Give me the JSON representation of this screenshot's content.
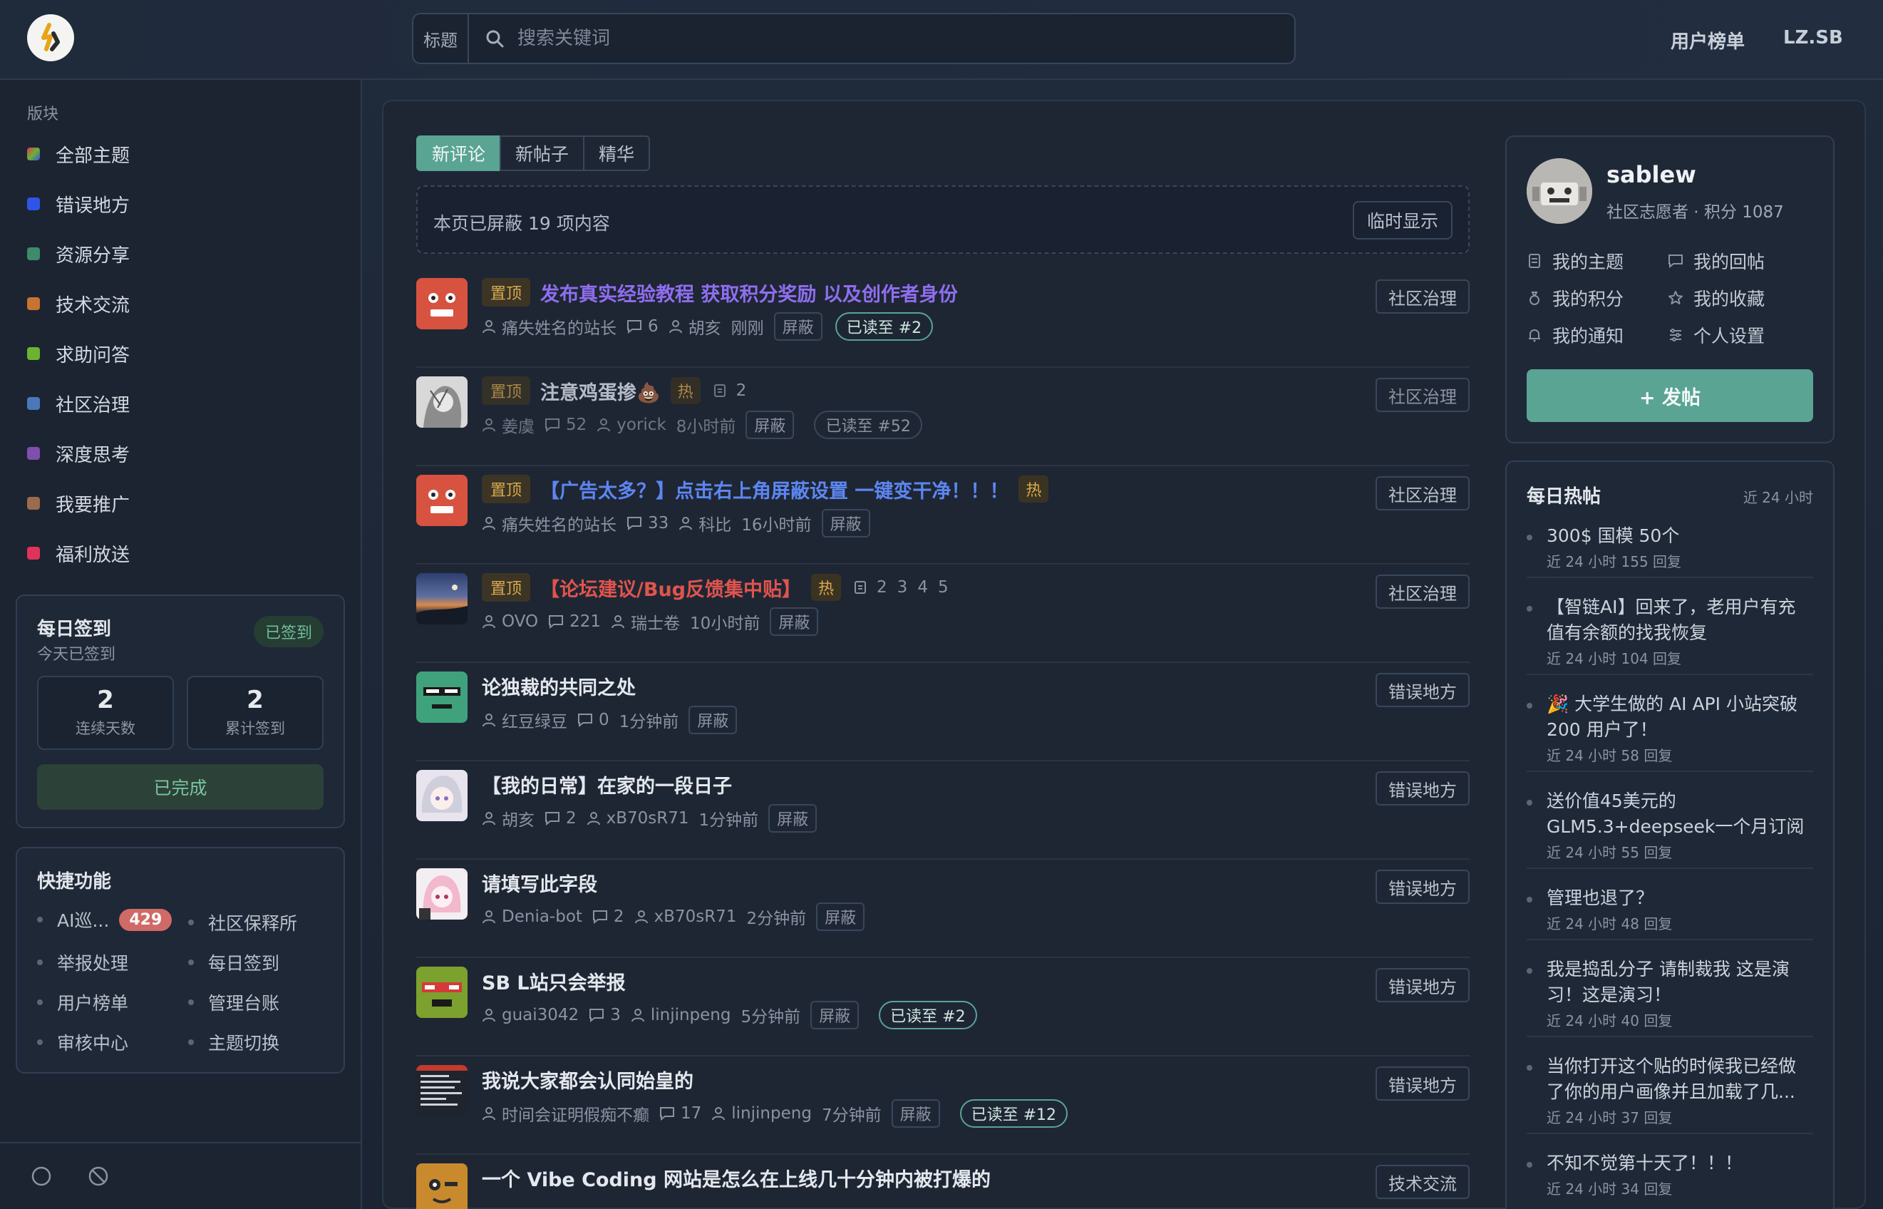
{
  "header": {
    "search_label": "标题",
    "search_placeholder": "搜索关键词",
    "links": [
      "用户榜单",
      "LZ.SB"
    ]
  },
  "sidebar": {
    "section_title": "版块",
    "items": [
      {
        "label": "全部主题",
        "color": "#c9577a"
      },
      {
        "label": "错误地方",
        "color": "#2f55e6"
      },
      {
        "label": "资源分享",
        "color": "#3e8a6a"
      },
      {
        "label": "技术交流",
        "color": "#c6742f"
      },
      {
        "label": "求助问答",
        "color": "#6cb32f"
      },
      {
        "label": "社区治理",
        "color": "#4a78b8"
      },
      {
        "label": "深度思考",
        "color": "#7e4fae"
      },
      {
        "label": "我要推广",
        "color": "#9a6b4d"
      },
      {
        "label": "福利放送",
        "color": "#e0325a"
      }
    ],
    "checkin": {
      "title": "每日签到",
      "subtitle": "今天已签到",
      "badge": "已签到",
      "streak_value": "2",
      "streak_label": "连续天数",
      "total_value": "2",
      "total_label": "累计签到",
      "button": "已完成"
    },
    "quick": {
      "title": "快捷功能",
      "items": [
        {
          "label": "AI巡...",
          "count": "429"
        },
        {
          "label": "社区保释所"
        },
        {
          "label": "举报处理"
        },
        {
          "label": "每日签到"
        },
        {
          "label": "用户榜单"
        },
        {
          "label": "管理台账"
        },
        {
          "label": "审核中心"
        },
        {
          "label": "主题切换"
        }
      ]
    }
  },
  "main": {
    "tabs": [
      "新评论",
      "新帖子",
      "精华"
    ],
    "blocked_text": "本页已屏蔽 19 项内容",
    "blocked_button": "临时显示",
    "posts": [
      {
        "pin": "置顶",
        "title": "发布真实经验教程 获取积分奖励 以及创作者身份",
        "author": "痛失姓名的站长",
        "replies": "6",
        "last": "胡亥",
        "time": "刚刚",
        "shield": "屏蔽",
        "read": "已读至 #2",
        "category": "社区治理"
      },
      {
        "pin": "置顶",
        "title": "注意鸡蛋掺💩",
        "hot": "热",
        "pages": [
          "2"
        ],
        "author": "姜虞",
        "replies": "52",
        "last": "yorick",
        "time": "8小时前",
        "shield": "屏蔽",
        "read": "已读至 #52",
        "category": "社区治理"
      },
      {
        "pin": "置顶",
        "title": "【广告太多？】点击右上角屏蔽设置 一键变干净！！！",
        "hot": "热",
        "author": "痛失姓名的站长",
        "replies": "33",
        "last": "科比",
        "time": "16小时前",
        "shield": "屏蔽",
        "category": "社区治理"
      },
      {
        "pin": "置顶",
        "title": "【论坛建议/Bug反馈集中贴】",
        "hot": "热",
        "pages": [
          "2",
          "3",
          "4",
          "5"
        ],
        "author": "OVO",
        "replies": "221",
        "last": "瑞士卷",
        "time": "10小时前",
        "shield": "屏蔽",
        "category": "社区治理"
      },
      {
        "title": "论独裁的共同之处",
        "author": "红豆绿豆",
        "replies": "0",
        "time": "1分钟前",
        "shield": "屏蔽",
        "category": "错误地方"
      },
      {
        "title": "【我的日常】在家的一段日子",
        "author": "胡亥",
        "replies": "2",
        "last": "xB70sR71",
        "time": "1分钟前",
        "shield": "屏蔽",
        "category": "错误地方"
      },
      {
        "title": "请填写此字段",
        "author": "Denia-bot",
        "replies": "2",
        "last": "xB70sR71",
        "time": "2分钟前",
        "shield": "屏蔽",
        "category": "错误地方"
      },
      {
        "title": "SB L站只会举报",
        "author": "guai3042",
        "replies": "3",
        "last": "linjinpeng",
        "time": "5分钟前",
        "shield": "屏蔽",
        "read": "已读至 #2",
        "category": "错误地方"
      },
      {
        "title": "我说大家都会认同始皇的",
        "author": "时间会证明假痴不癫",
        "replies": "17",
        "last": "linjinpeng",
        "time": "7分钟前",
        "shield": "屏蔽",
        "read": "已读至 #12",
        "category": "错误地方"
      },
      {
        "title": "一个 Vibe Coding 网站是怎么在上线几十分钟内被打爆的",
        "category": "技术交流"
      }
    ]
  },
  "user": {
    "name": "sablew",
    "subtitle": "社区志愿者 · 积分 1087",
    "links": [
      "我的主题",
      "我的回帖",
      "我的积分",
      "我的收藏",
      "我的通知",
      "个人设置"
    ],
    "post_button": "+ 发帖"
  },
  "hot": {
    "title": "每日热帖",
    "range": "近 24 小时",
    "items": [
      {
        "title": "300$ 国模 50个",
        "stat": "近 24 小时 155 回复"
      },
      {
        "title": "【智链AI】回来了，老用户有充值有余额的找我恢复",
        "stat": "近 24 小时 104 回复"
      },
      {
        "title": "🎉 大学生做的 AI API 小站突破 200 用户了！",
        "stat": "近 24 小时 58 回复"
      },
      {
        "title": "送价值45美元的GLM5.3+deepseek一个月订阅",
        "stat": "近 24 小时 55 回复"
      },
      {
        "title": "管理也退了？",
        "stat": "近 24 小时 48 回复"
      },
      {
        "title": "我是捣乱分子 请制裁我 这是演习！这是演习！",
        "stat": "近 24 小时 40 回复"
      },
      {
        "title": "当你打开这个贴的时候我已经做了你的用户画像并且加载了几...",
        "stat": "近 24 小时 37 回复"
      },
      {
        "title": "不知不觉第十天了！！！",
        "stat": "近 24 小时 34 回复"
      }
    ]
  }
}
